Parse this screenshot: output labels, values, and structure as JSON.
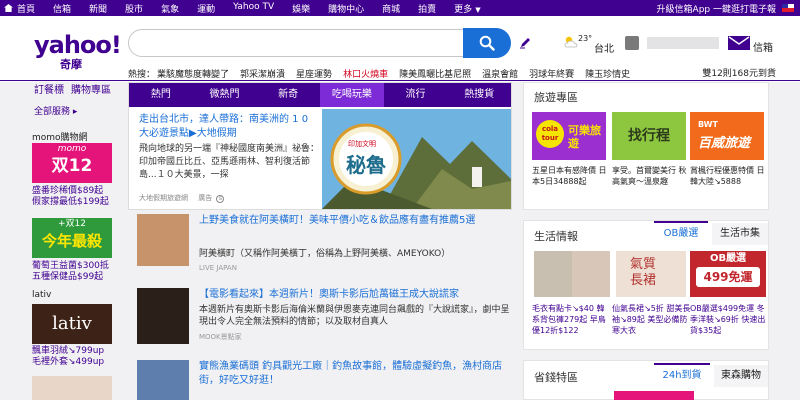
{
  "topnav": {
    "links": [
      "首頁",
      "信箱",
      "新聞",
      "股市",
      "氣象",
      "運動",
      "Yahoo TV",
      "娛樂",
      "購物中心",
      "商城",
      "拍賣",
      "更多"
    ],
    "right_text": "升級信箱App 一鍵逛打電子報"
  },
  "header": {
    "logo": "yahoo!",
    "logo_sub": "奇摩",
    "temperature": "23°",
    "city": "台北",
    "mail_label": "信箱",
    "hot_label": "熱搜：",
    "hot_items": [
      "業駭魔態度轉變了",
      "郭采潔崩潰",
      "星座運勢",
      "林口火燒車",
      "陳美鳳曬比基尼照",
      "溫泉會館",
      "羽球年終賽",
      "陳玉珍情史"
    ],
    "hot_red_index": 3,
    "hot_right": "雙12則168元到貨",
    "menu_left": "訂餐標",
    "menu_sub": "購物專區",
    "all_services": "全部服務 ▸"
  },
  "left_col": {
    "momo_label": "momo購物網",
    "momo_banner_top": "momo",
    "momo_banner_main": "双12",
    "momo_caption": "盛番珍稀價$89起 假家撐最低$199起",
    "green_banner_top": "+双12",
    "green_banner_main": "今年最殺",
    "green_caption": "葡萄王益菌$300抵 五種保健品$99起",
    "lativ_label": "lativ",
    "lativ_banner": "lativ",
    "lativ_caption": "飄車羽絨↘799up 毛裡外套↘499up"
  },
  "feature": {
    "tabs": [
      "熱門",
      "微熱門",
      "新奇",
      "吃喝玩樂",
      "流行",
      "熱搜貨"
    ],
    "active_tab": 3,
    "title": "走出台北市，達人帶路：南美洲的 1 0 大必遊景點▶大地假期",
    "desc": "飛向地球的另一端『神秘國度南美洲』祕魯：印加帝國丘比丘、亞馬遜雨林、智利復活節島...１０大美景，一探",
    "ad_source": "大地假期旅遊網",
    "ad_label": "廣告",
    "image_text": "秘魯",
    "image_small": "印加文明"
  },
  "news": [
    {
      "title": "上野美食就在阿美橫町！美味平價小吃＆飲品應有盡有推薦5選",
      "desc": "阿美橫町（又稱作阿美橫丁，俗稱為上野阿美橫、AMEYOKO）",
      "source": "LIVE JAPAN"
    },
    {
      "title": "【電影看起來】本週新片！奧斯卡影后尬萬磁王成大說謊家",
      "desc": "本週新片有奧斯卡影后海倫米蘭與伊恩麥克連同台飆戲的『大說謊家』，劇中呈現出令人完全無法預料的情節；以及取材自真人",
      "source": "MOOK景點家"
    },
    {
      "title": "實熊漁業碼頭 釣具觀光工廠｜釣魚故事館，體驗虛擬釣魚，漁村商店街，好吃又好逛！",
      "desc": "",
      "source": ""
    }
  ],
  "right": {
    "travel_title": "旅遊專區",
    "travel_tiles": [
      {
        "brand": "cola tour",
        "text": "可樂旅遊",
        "color": "#9b2fd0"
      },
      {
        "brand": "",
        "text": "找行程",
        "color": "#8dc63f"
      },
      {
        "brand": "BWT",
        "text": "百威旅遊",
        "color": "#f26a1b"
      }
    ],
    "travel_captions": [
      "五星日本有感降價 日本5日34888起",
      "享受。首爾變美行 秋高氣爽～溫泉趣",
      "賞楓行程優惠特價 日韓大陸↘5888"
    ],
    "life_title": "生活情報",
    "life_tabs": [
      "OB嚴選",
      "生活市集"
    ],
    "life_active": 0,
    "product_captions": [
      "毛衣有點卡↘$40 韓系背包褲279起 早鳥優12折$122",
      "仙氣長裙↘5折 甜美長袖↘89起 美型必備防寒大衣",
      "OB嚴選$499免運 冬季洋裝↘69折 快速出貨$35起"
    ],
    "ob_banner_main": "499免運",
    "ob_banner_top": "OB嚴選",
    "long_skirt": "氣質長裙",
    "saving_title": "省錢特區",
    "saving_tabs": [
      "24h到貨",
      "東森購物"
    ],
    "saving_active": 0
  },
  "colors": {
    "brand_purple": "#400090",
    "link_blue": "#1a6fd6",
    "search_blue": "#1a6fd6"
  }
}
